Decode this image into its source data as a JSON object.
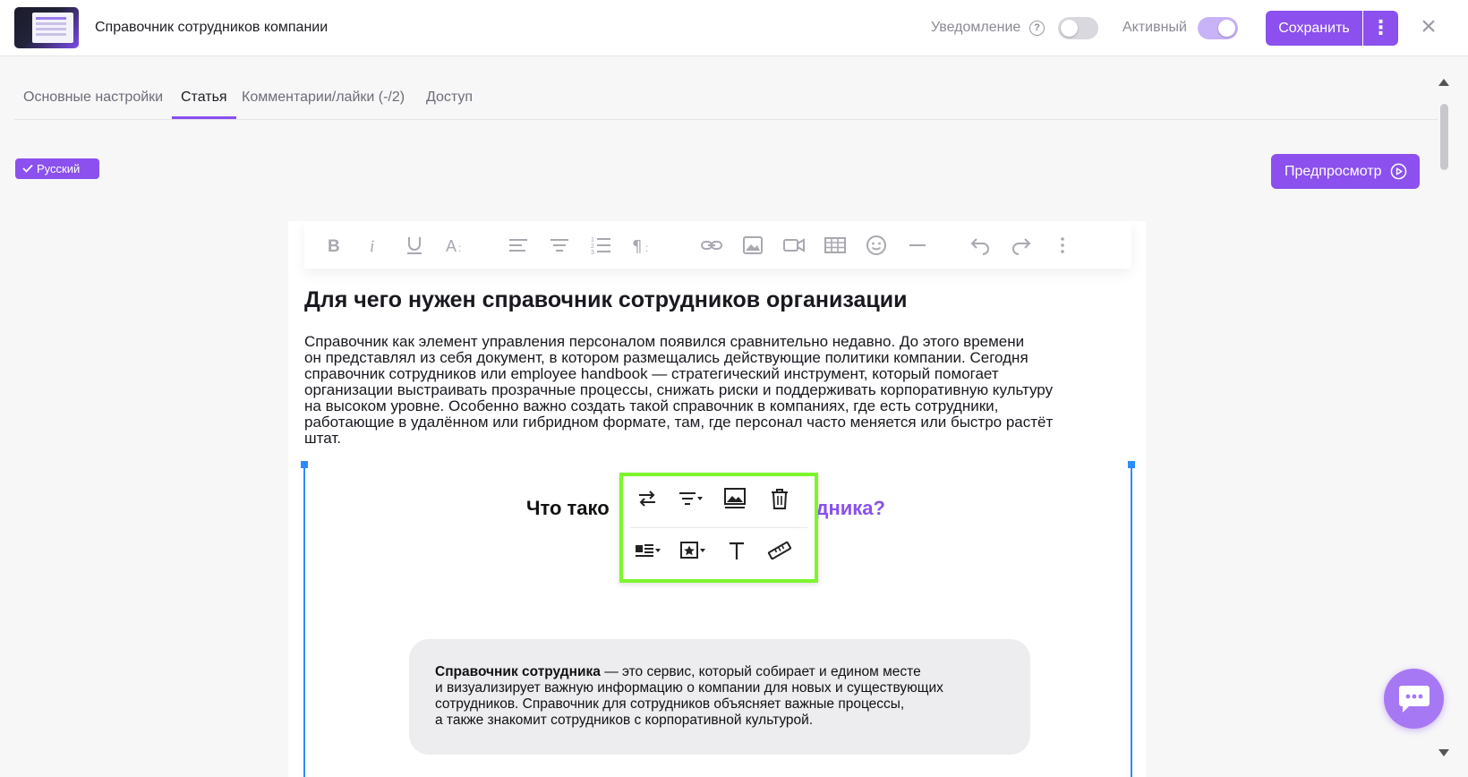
{
  "header": {
    "title": "Справочник сотрудников компании",
    "notification_label": "Уведомление",
    "active_label": "Активный",
    "save_label": "Сохранить"
  },
  "tabs": [
    {
      "label": "Основные настройки",
      "active": false
    },
    {
      "label": "Статья",
      "active": true
    },
    {
      "label": "Комментарии/лайки (-/2)",
      "active": false
    },
    {
      "label": "Доступ",
      "active": false
    }
  ],
  "language_badge": "Русский",
  "preview_label": "Предпросмотр",
  "toolbar_icons": [
    "bold-icon",
    "italic-icon",
    "underline-icon",
    "font-size-icon",
    "align-left-icon",
    "align-center-icon",
    "ordered-list-icon",
    "paragraph-format-icon",
    "link-icon",
    "image-icon",
    "video-icon",
    "table-icon",
    "emoji-icon",
    "horizontal-line-icon",
    "undo-icon",
    "redo-icon",
    "more-icon"
  ],
  "article": {
    "heading": "Для чего нужен справочник сотрудников организации",
    "lines": [
      "Справочник как элемент управления персоналом появился сравнительно недавно. До этого времени",
      "он представлял из себя документ, в котором размещались действующие политики компании. Сегодня",
      "справочник сотрудников или employee handbook — стратегический инструмент, который помогает",
      "организации выстраивать прозрачные процессы, снижать риски и поддерживать корпоративную культуру",
      "на высоком уровне. Особенно важно создать такой справочник в компаниях, где есть сотрудники,",
      "работающие в удалённом или гибридном формате, там, где персонал часто меняется или быстро растёт",
      "штат."
    ]
  },
  "image_block": {
    "heading_left": "Что тако",
    "heading_right": "рудника?",
    "card_bold": "Справочник сотрудника",
    "card_lines": [
      " — это сервис, который собирает и едином месте",
      "и визуализирует важную информацию о компании для новых и существующих",
      "сотрудников. Справочник для сотрудников объясняет важные процессы,",
      "а также знакомит сотрудников с корпоративной культурой."
    ]
  },
  "image_toolbar_icons": [
    "replace-image-icon",
    "align-image-icon",
    "image-caption-icon",
    "delete-image-icon",
    "display-icon",
    "image-style-icon",
    "alt-text-icon",
    "image-size-icon"
  ],
  "colors": {
    "accent": "#8b50ee",
    "highlight_border": "#7df52c",
    "selection": "#2b8cff"
  },
  "toggles": {
    "notification": false,
    "active": true
  }
}
